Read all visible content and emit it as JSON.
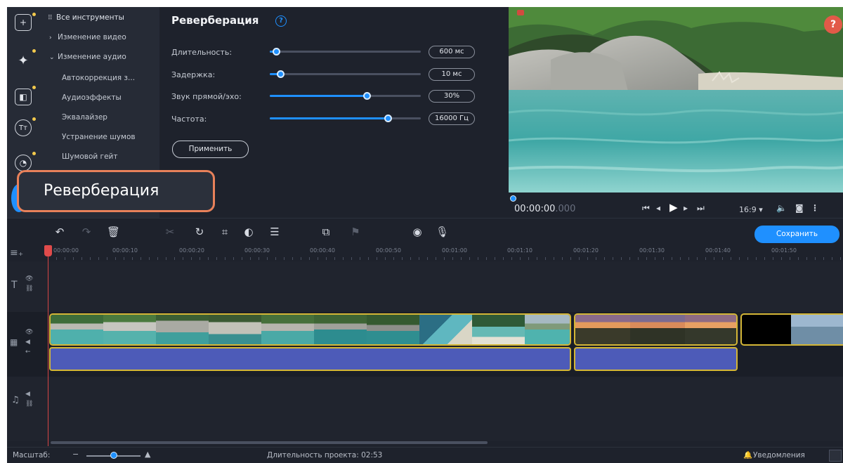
{
  "tools": {
    "all_tools": "Все инструменты",
    "cat_video": "Изменение видео",
    "cat_audio": "Изменение аудио",
    "items": [
      "Автокоррекция з...",
      "Аудиоэффекты",
      "Эквалайзер",
      "Устранение шумов",
      "Шумовой гейт"
    ]
  },
  "settings": {
    "title": "Реверберация",
    "help": "?",
    "params": [
      {
        "label": "Длительность:",
        "value": "600 мс",
        "level": 0.04
      },
      {
        "label": "Задержка:",
        "value": "10 мс",
        "level": 0.07
      },
      {
        "label": "Звук прямой/эхо:",
        "value": "30%",
        "level": 0.64
      },
      {
        "label": "Частота:",
        "value": "16000 Гц",
        "level": 0.78
      }
    ],
    "apply": "Применить"
  },
  "callout": {
    "text": "Реверберация"
  },
  "preview": {
    "help": "?",
    "timecode_main": "00:00:00",
    "timecode_ms": ".000",
    "aspect": "16:9 ▾"
  },
  "toolbar": {
    "save": "Сохранить"
  },
  "ruler": {
    "ticks": [
      "00:00:00",
      "00:00:10",
      "00:00:20",
      "00:00:30",
      "00:00:40",
      "00:00:50",
      "00:01:00",
      "00:01:10",
      "00:01:20",
      "00:01:30",
      "00:01:40",
      "00:01:50"
    ]
  },
  "status": {
    "zoom_label": "Масштаб:",
    "duration": "Длительность проекта: 02:53",
    "notifications": "Уведомления"
  },
  "colors": {
    "accent": "#1f90ff",
    "clip_border": "#d4b636",
    "audio_clip": "#4d5bb8",
    "callout_border": "#e8815a",
    "playhead": "#d64545"
  }
}
